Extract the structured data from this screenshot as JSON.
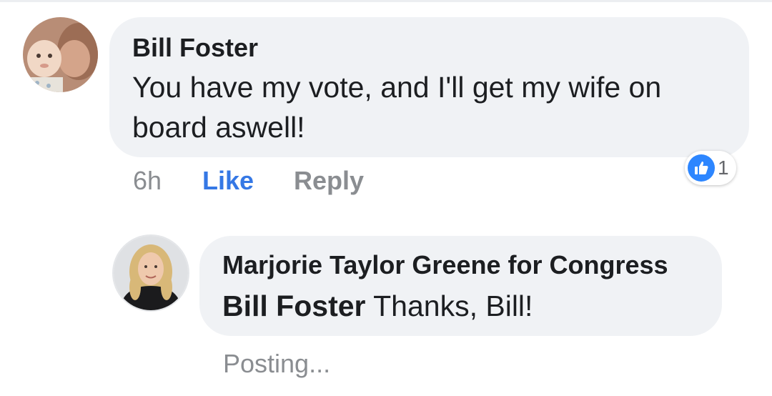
{
  "comment": {
    "author": "Bill Foster",
    "text": "You have my vote, and I'll get my wife on board aswell!",
    "time": "6h",
    "like_label": "Like",
    "reply_label": "Reply",
    "reaction": {
      "type": "like",
      "icon": "thumbs-up-icon",
      "count": "1",
      "color": "#2d86ff"
    }
  },
  "reply": {
    "author": "Marjorie Taylor Greene for Congress",
    "mention": "Bill Foster",
    "text": " Thanks, Bill!",
    "status": "Posting..."
  },
  "colors": {
    "bubble": "#f0f2f5",
    "link_blue": "#3578e5",
    "muted_gray": "#8a8d91",
    "text": "#1c1e21"
  }
}
